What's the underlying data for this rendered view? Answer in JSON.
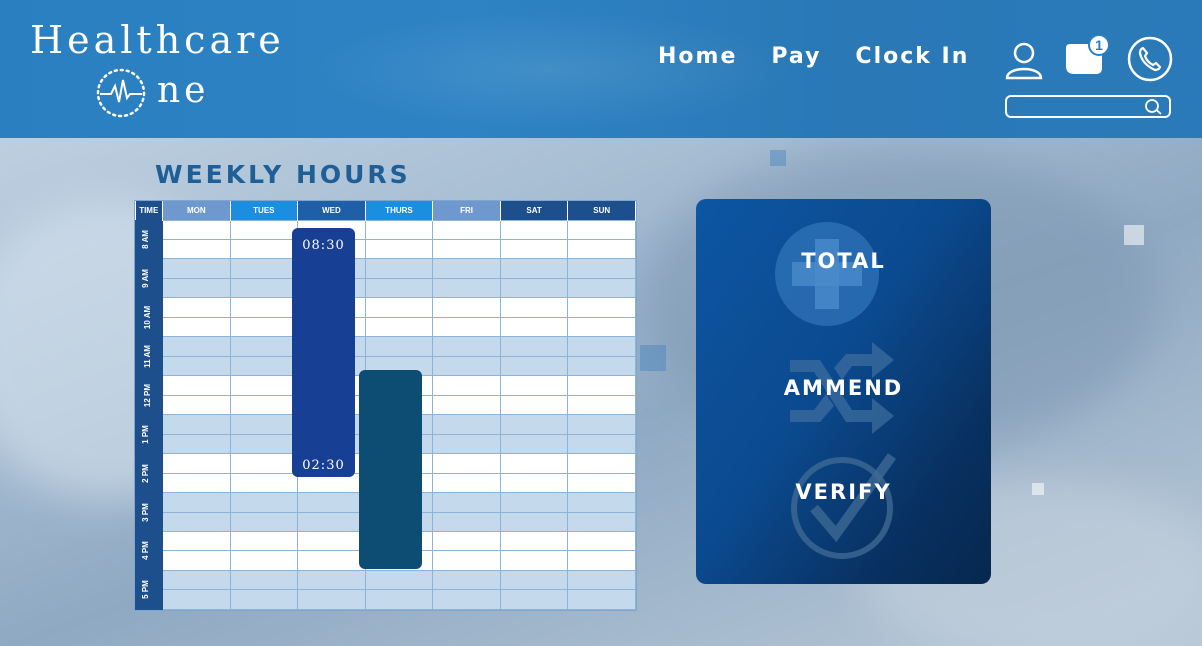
{
  "brand": {
    "line1": "Healthcare",
    "line2": "ne"
  },
  "nav": {
    "home": "Home",
    "pay": "Pay",
    "clock_in": "Clock In"
  },
  "header_icons": {
    "user": "user-icon",
    "messages": "chat-icon",
    "phone": "phone-icon",
    "search": "search-icon"
  },
  "notifications": {
    "count": "1"
  },
  "search": {
    "value": ""
  },
  "weekly": {
    "title": "WEEKLY HOURS",
    "columns": [
      "TIME",
      "MON",
      "TUES",
      "WED",
      "THURS",
      "FRI",
      "SAT",
      "SUN"
    ],
    "header_colors": [
      "#1e4f8d",
      "#6f98cf",
      "#1c8ee0",
      "#1e5fa8",
      "#1c8ee0",
      "#6f98cf",
      "#1e4f8d",
      "#1e4f8d"
    ],
    "times": [
      "8 AM",
      "9 AM",
      "10 AM",
      "11 AM",
      "12 PM",
      "1 PM",
      "2 PM",
      "3 PM",
      "4 PM",
      "5 PM"
    ],
    "shift_wed": {
      "start": "08:30",
      "end": "02:30"
    }
  },
  "panel": {
    "total": "TOTAL",
    "amend": "AMMEND",
    "verify": "VERIFY"
  }
}
